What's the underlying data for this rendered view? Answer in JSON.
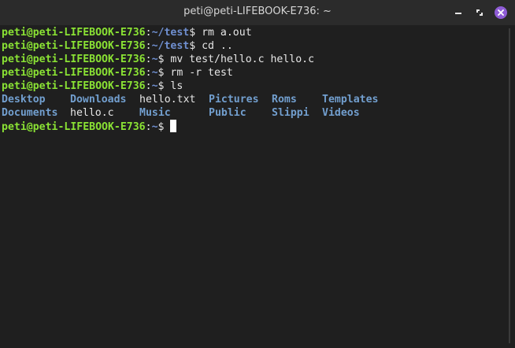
{
  "window": {
    "title": "peti@peti-LIFEBOOK-E736: ~",
    "controls": [
      "minimize-icon",
      "maximize-icon",
      "close-icon"
    ],
    "accent": "#8f5cd6"
  },
  "colors": {
    "user_host": "#8ae234",
    "path": "#6f8fd0",
    "directory": "#729fcf",
    "text": "#e6e6e6",
    "background": "#1f1f1f"
  },
  "terminal": {
    "lines": [
      {
        "user": "peti@peti-LIFEBOOK-E736",
        "path": "~/test",
        "command": " rm a.out"
      },
      {
        "user": "peti@peti-LIFEBOOK-E736",
        "path": "~/test",
        "command": " cd .."
      },
      {
        "user": "peti@peti-LIFEBOOK-E736",
        "path": "~",
        "command": " mv test/hello.c hello.c"
      },
      {
        "user": "peti@peti-LIFEBOOK-E736",
        "path": "~",
        "command": " rm -r test"
      },
      {
        "user": "peti@peti-LIFEBOOK-E736",
        "path": "~",
        "command": " ls"
      }
    ],
    "ls_output": {
      "row1": [
        "Desktop",
        "Downloads",
        "hello.txt",
        "Pictures",
        "Roms",
        "Templates"
      ],
      "row2": [
        "Documents",
        "hello.c",
        "Music",
        "Public",
        "Slippi",
        "Videos"
      ]
    },
    "current_prompt": {
      "user": "peti@peti-LIFEBOOK-E736",
      "path": "~",
      "dollar": "$ "
    },
    "colon": ":",
    "dollar": "$"
  }
}
